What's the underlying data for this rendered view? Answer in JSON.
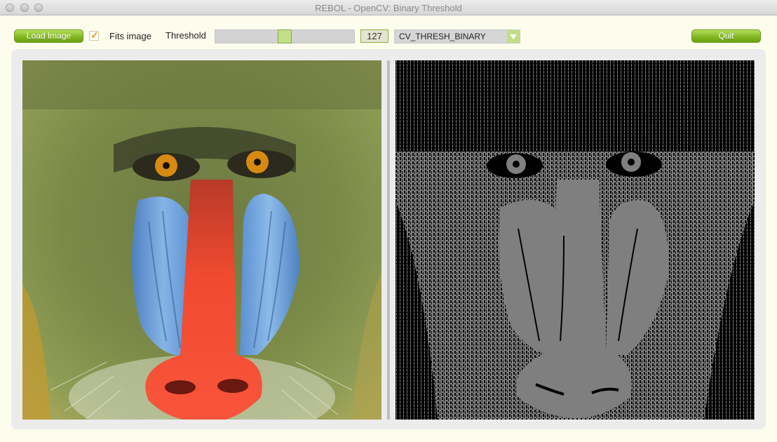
{
  "window": {
    "title": "REBOL - OpenCV: Binary Threshold"
  },
  "toolbar": {
    "load_label": "Load Image",
    "fits_checked": true,
    "fits_label": "Fits image",
    "threshold_label": "Threshold",
    "threshold_value": "127",
    "threshold_fraction": 0.5,
    "mode_value": "CV_THRESH_BINARY",
    "quit_label": "Quit"
  },
  "images": {
    "source": "baboon-color-icon",
    "result": "baboon-binary-icon"
  },
  "colors": {
    "accent": "#7fb51f",
    "slider_knob": "#c2de86",
    "background": "#fdfdee"
  }
}
